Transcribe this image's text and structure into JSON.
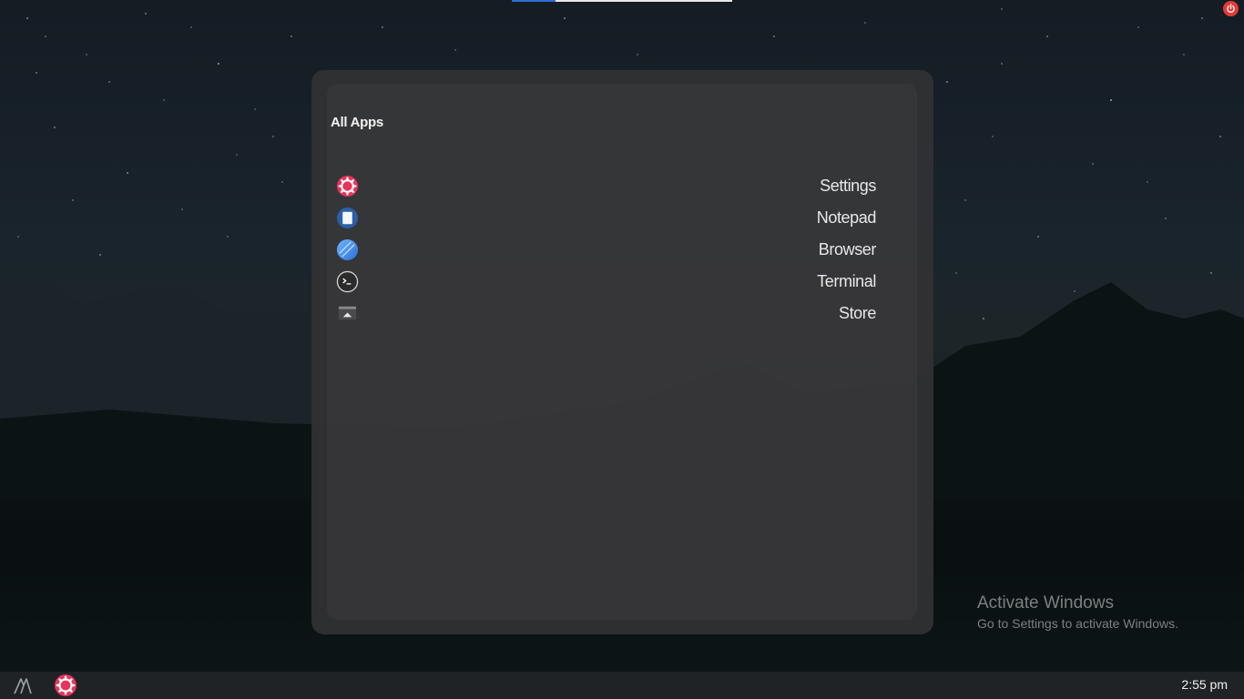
{
  "desktop": {
    "wallpaper": "night-sky-mountains-lake"
  },
  "top_bar": {
    "accent_color": "#2f6fd6"
  },
  "power_button": {
    "icon": "power-icon",
    "color": "#e53935"
  },
  "app_panel": {
    "title": "All Apps",
    "apps": [
      {
        "label": "Settings",
        "icon": "settings-gear-icon",
        "color": "#e8345a"
      },
      {
        "label": "Notepad",
        "icon": "notepad-icon",
        "color": "#2d5fa8"
      },
      {
        "label": "Browser",
        "icon": "browser-globe-icon",
        "color": "#4a90e2"
      },
      {
        "label": "Terminal",
        "icon": "terminal-icon",
        "color": "#333333"
      },
      {
        "label": "Store",
        "icon": "store-icon",
        "color": "#dddddd"
      }
    ]
  },
  "watermark": {
    "title": "Activate Windows",
    "subtitle": "Go to Settings to activate Windows."
  },
  "taskbar": {
    "launcher_icon": "launcher-icon",
    "pinned": [
      {
        "icon": "settings-gear-icon",
        "color": "#e8345a"
      }
    ],
    "clock": "2:55 pm"
  }
}
